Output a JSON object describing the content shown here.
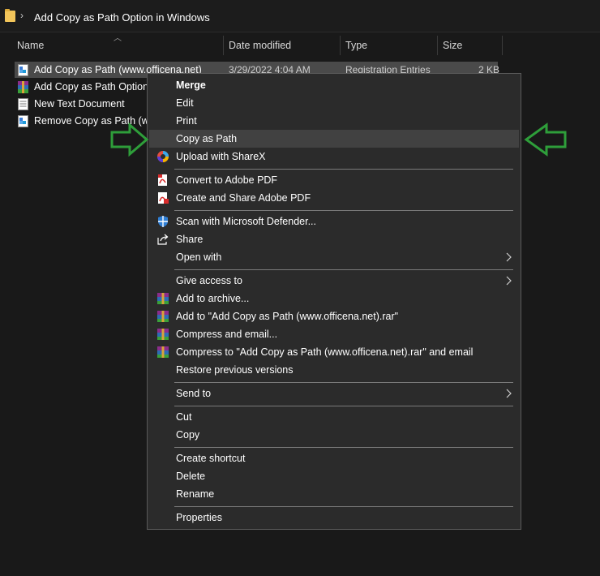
{
  "address_bar": {
    "title": "Add Copy as Path Option in Windows"
  },
  "columns": {
    "name": "Name",
    "date": "Date modified",
    "type": "Type",
    "size": "Size"
  },
  "files": [
    {
      "name": "Add Copy as Path (www.officena.net)",
      "date": "3/29/2022 4:04 AM",
      "type": "Registration Entries",
      "size": "2 KB"
    },
    {
      "name": "Add Copy as Path Option i"
    },
    {
      "name": "New Text Document"
    },
    {
      "name": "Remove Copy as Path (ww"
    }
  ],
  "menu": {
    "items": [
      {
        "label": "Merge"
      },
      {
        "label": "Edit"
      },
      {
        "label": "Print"
      },
      {
        "label": "Copy as Path"
      },
      {
        "label": "Upload with ShareX",
        "icon": "sharex-icon"
      },
      {
        "label": "Convert to Adobe PDF",
        "icon": "adobe-pdf-icon"
      },
      {
        "label": "Create and Share Adobe PDF",
        "icon": "adobe-pdf-share-icon"
      },
      {
        "label": "Scan with Microsoft Defender...",
        "icon": "defender-shield-icon"
      },
      {
        "label": "Share",
        "icon": "share-icon"
      },
      {
        "label": "Open with"
      },
      {
        "label": "Give access to"
      },
      {
        "label": "Add to archive...",
        "icon": "winrar-icon"
      },
      {
        "label": "Add to \"Add Copy as Path (www.officena.net).rar\"",
        "icon": "winrar-icon"
      },
      {
        "label": "Compress and email...",
        "icon": "winrar-icon"
      },
      {
        "label": "Compress to \"Add Copy as Path (www.officena.net).rar\" and email",
        "icon": "winrar-icon"
      },
      {
        "label": "Restore previous versions"
      },
      {
        "label": "Send to"
      },
      {
        "label": "Cut"
      },
      {
        "label": "Copy"
      },
      {
        "label": "Create shortcut"
      },
      {
        "label": "Delete"
      },
      {
        "label": "Rename"
      },
      {
        "label": "Properties"
      }
    ]
  },
  "colors": {
    "background": "#191919",
    "menu_background": "#2b2b2b",
    "menu_hover": "#414141",
    "selection": "#4a4a4a",
    "annotation_arrow": "#2e9e3a"
  }
}
